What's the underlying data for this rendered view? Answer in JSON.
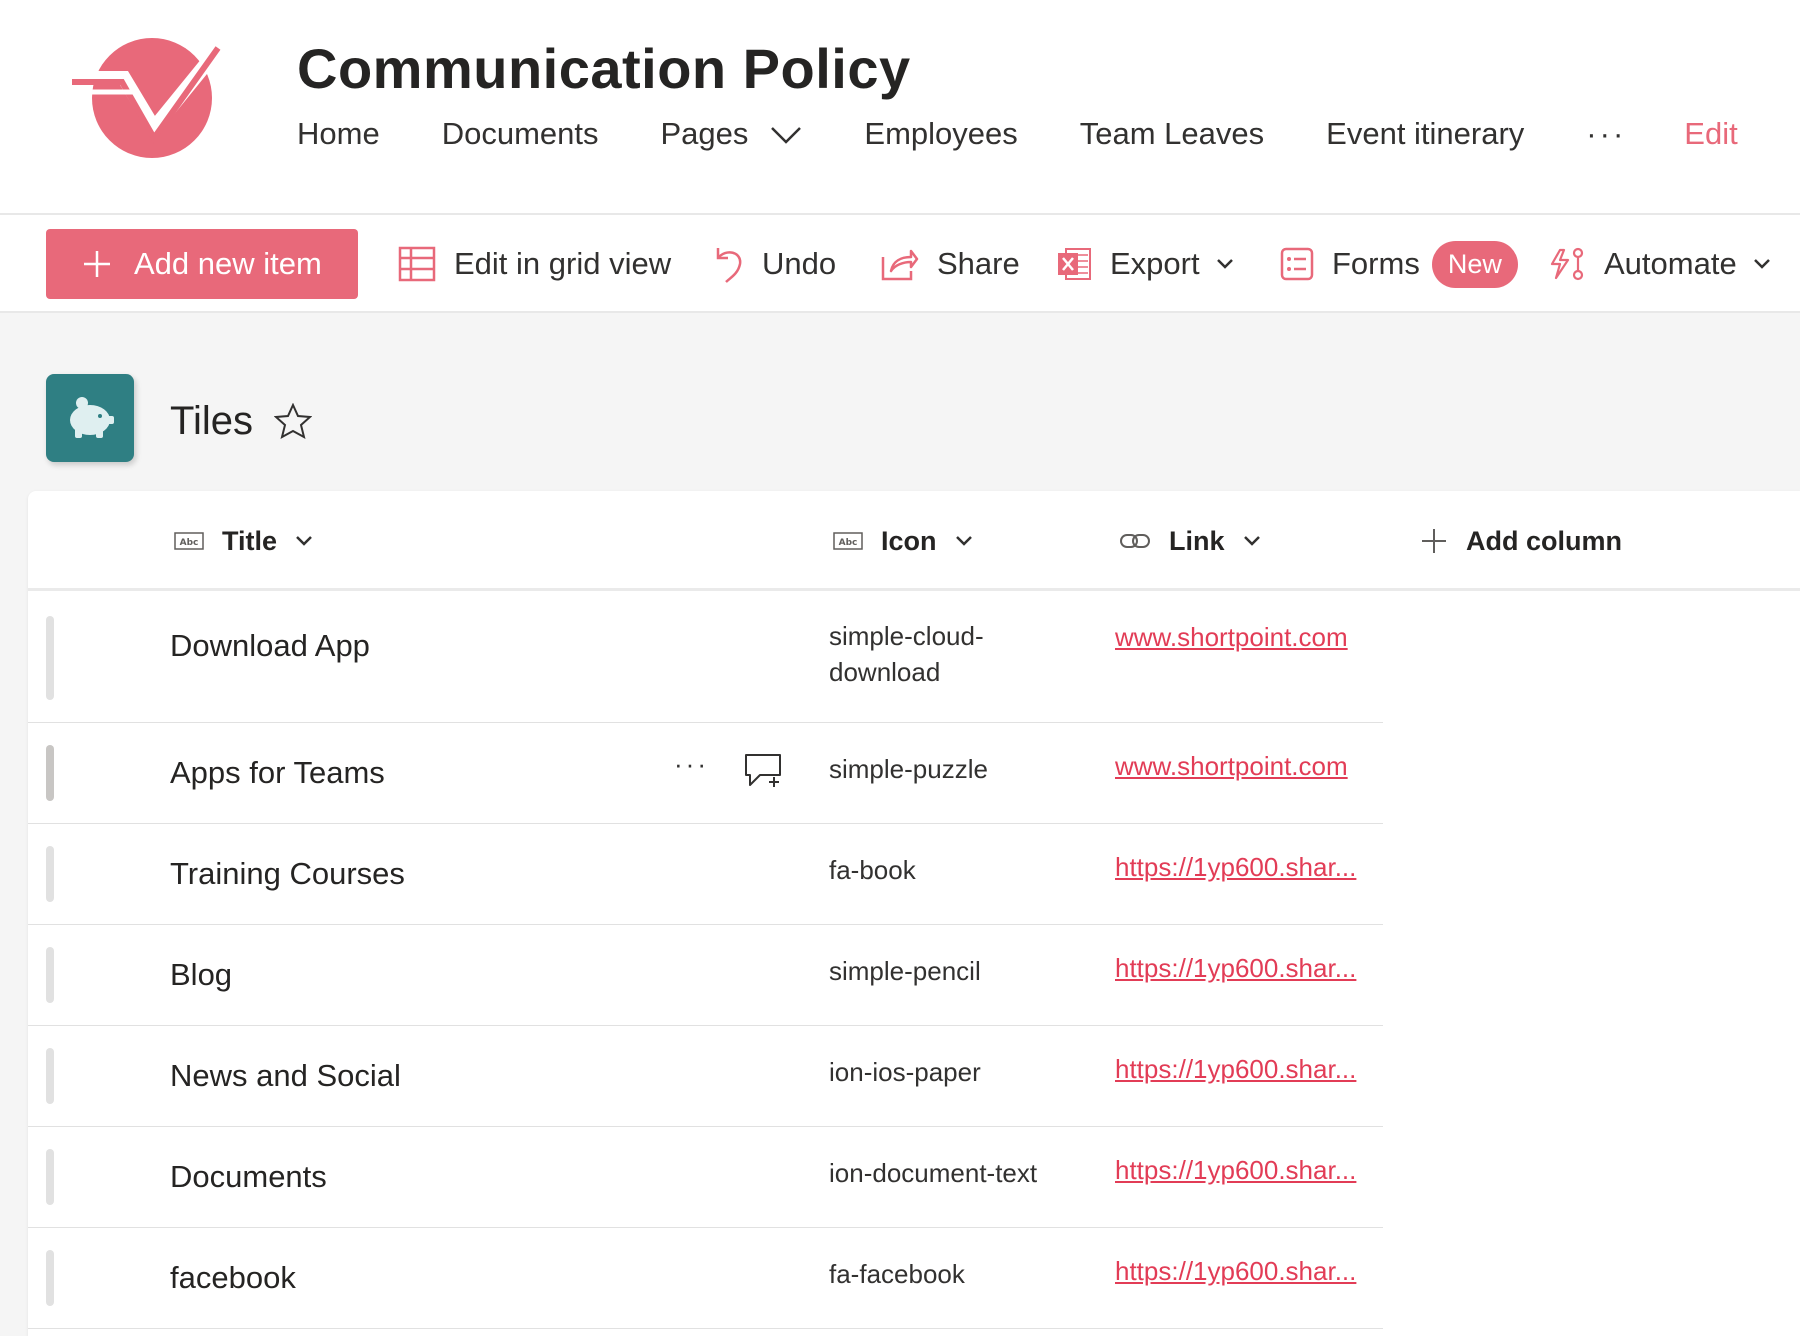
{
  "site": {
    "title": "Communication Policy",
    "accent_color": "#e8697a",
    "logo_icon": "checkmark-logo"
  },
  "nav": {
    "items": [
      {
        "label": "Home"
      },
      {
        "label": "Documents"
      },
      {
        "label": "Pages",
        "has_dropdown": true
      },
      {
        "label": "Employees"
      },
      {
        "label": "Team Leaves"
      },
      {
        "label": "Event itinerary"
      }
    ],
    "more_label": "···",
    "edit_label": "Edit"
  },
  "commandbar": {
    "add_new_item": "Add new item",
    "edit_grid": "Edit in grid view",
    "undo": "Undo",
    "share": "Share",
    "export": "Export",
    "forms": "Forms",
    "forms_badge": "New",
    "automate": "Automate"
  },
  "list": {
    "title": "Tiles",
    "icon": "piggy-bank-icon",
    "icon_color": "#2f7f83",
    "columns": {
      "title": "Title",
      "icon": "Icon",
      "link": "Link",
      "add_column": "Add column"
    },
    "rows": [
      {
        "title": "Download App",
        "icon": "simple-cloud-download",
        "link": "www.shortpoint.com"
      },
      {
        "title": "Apps for Teams",
        "icon": "simple-puzzle",
        "link": "www.shortpoint.com",
        "row_more": "···"
      },
      {
        "title": "Training Courses",
        "icon": "fa-book",
        "link": "https://1yp600.shar..."
      },
      {
        "title": "Blog",
        "icon": "simple-pencil",
        "link": "https://1yp600.shar..."
      },
      {
        "title": "News and Social",
        "icon": "ion-ios-paper",
        "link": "https://1yp600.shar..."
      },
      {
        "title": "Documents",
        "icon": "ion-document-text",
        "link": "https://1yp600.shar..."
      },
      {
        "title": "facebook",
        "icon": "fa-facebook",
        "link": "https://1yp600.shar..."
      }
    ]
  }
}
